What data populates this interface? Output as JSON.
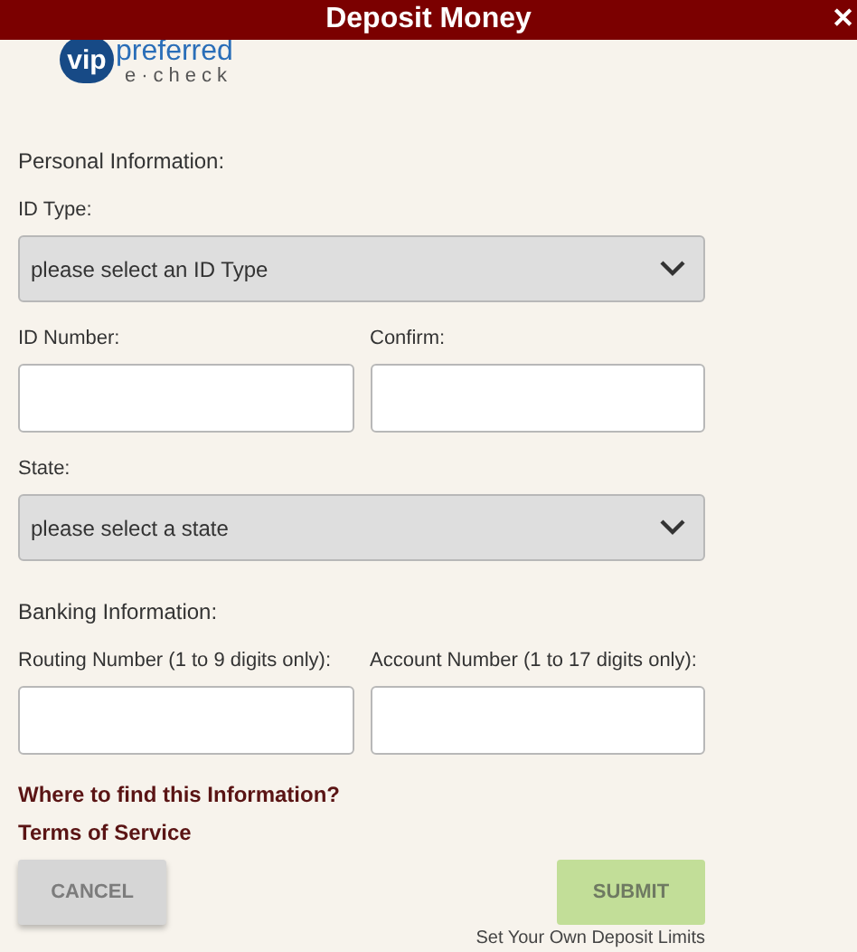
{
  "window": {
    "title": "Deposit Money",
    "close": "✕"
  },
  "logo": {
    "brand": "vip",
    "name": "preferred",
    "sub": "e·check"
  },
  "personal": {
    "heading": "Personal Information:",
    "id_type": {
      "label": "ID Type:",
      "placeholder": "please select an ID Type"
    },
    "id_number": {
      "label": "ID Number:"
    },
    "confirm": {
      "label": "Confirm:"
    },
    "state": {
      "label": "State:",
      "placeholder": "please select a state"
    }
  },
  "banking": {
    "heading": "Banking Information:",
    "routing": {
      "label": "Routing Number (1 to 9 digits only):"
    },
    "account": {
      "label": "Account Number (1 to 17 digits only):"
    }
  },
  "links": [
    "Where to find this Information?",
    "Terms of Service"
  ],
  "buttons": [
    {
      "label": "CANCEL",
      "kind": "cancel",
      "disabled": true
    },
    {
      "label": "SUBMIT",
      "kind": "submit",
      "disabled": true
    }
  ],
  "footer_link": "Set Your Own Deposit Limits"
}
